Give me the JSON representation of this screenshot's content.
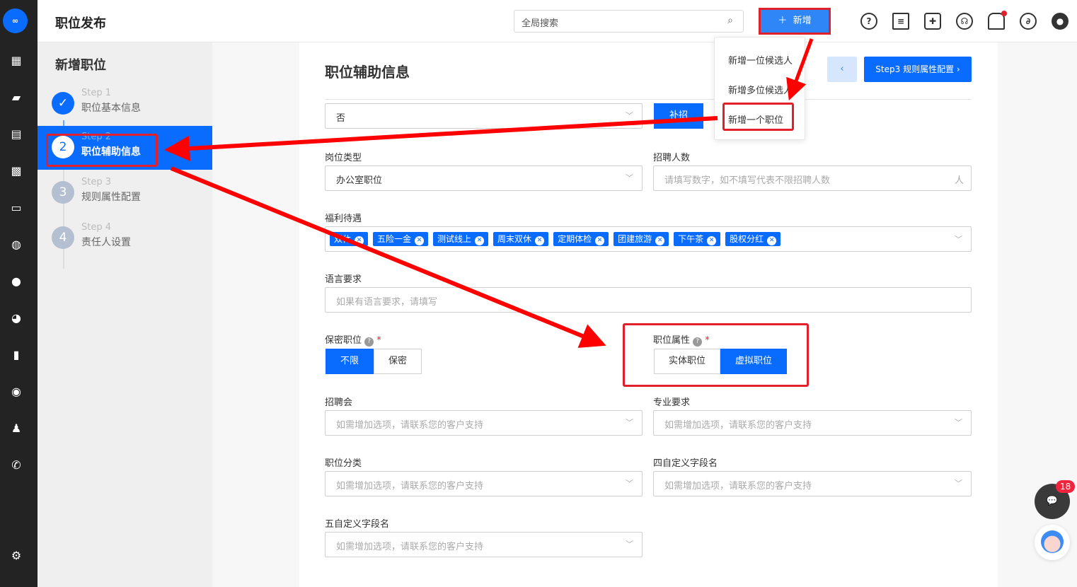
{
  "app": {
    "logo": "BizScenes",
    "page_title": "职位发布"
  },
  "rail": {
    "icons": [
      "dashboard-icon",
      "briefcase-icon",
      "resume-icon",
      "calendar-icon",
      "id-card-icon",
      "wechat-icon",
      "thumbs-up-icon",
      "pie-chart-icon",
      "bar-chart-icon",
      "user-circle-icon",
      "users-icon",
      "phone-icon",
      "settings-icon"
    ]
  },
  "header": {
    "search_placeholder": "全局搜索",
    "add_label": "新增",
    "add_menu": [
      "新增一位候选人",
      "新增多位候选人",
      "新增一个职位"
    ],
    "icons": [
      "help-icon",
      "document-icon",
      "puzzle-icon",
      "head-icon",
      "bell-icon",
      "link-icon",
      "user-icon"
    ]
  },
  "steps": {
    "title": "新增职位",
    "items": [
      {
        "step": "Step 1",
        "label": "职位基本信息",
        "num": "✓"
      },
      {
        "step": "Step 2",
        "label": "职位辅助信息",
        "num": "2"
      },
      {
        "step": "Step 3",
        "label": "规则属性配置",
        "num": "3"
      },
      {
        "step": "Step 4",
        "label": "责任人设置",
        "num": "4"
      }
    ]
  },
  "form": {
    "title": "职位辅助信息",
    "next_label": "Step3 规则属性配置 ›",
    "prev_label": "‹",
    "replenish": {
      "value": "否",
      "button": "补招"
    },
    "post_type": {
      "label": "岗位类型",
      "value": "办公室职位"
    },
    "headcount": {
      "label": "招聘人数",
      "placeholder": "请填写数字，如不填写代表不限招聘人数",
      "unit": "人"
    },
    "benefits": {
      "label": "福利待遇",
      "tags": [
        "双休",
        "五险一金",
        "测试线上",
        "周末双休",
        "定期体检",
        "团建旅游",
        "下午茶",
        "股权分红"
      ]
    },
    "language": {
      "label": "语言要求",
      "placeholder": "如果有语言要求，请填写"
    },
    "secret": {
      "label": "保密职位",
      "options": [
        "不限",
        "保密"
      ],
      "selected": "不限"
    },
    "attribute": {
      "label": "职位属性",
      "options": [
        "实体职位",
        "虚拟职位"
      ],
      "selected": "虚拟职位"
    },
    "job_fair": {
      "label": "招聘会",
      "placeholder": "如需增加选项，请联系您的客户支持"
    },
    "major": {
      "label": "专业要求",
      "placeholder": "如需增加选项，请联系您的客户支持"
    },
    "category": {
      "label": "职位分类",
      "placeholder": "如需增加选项，请联系您的客户支持"
    },
    "custom4": {
      "label": "四自定义字段名",
      "placeholder": "如需增加选项，请联系您的客户支持"
    },
    "custom5": {
      "label": "五自定义字段名",
      "placeholder": "如需增加选项，请联系您的客户支持"
    }
  },
  "widgets": {
    "chat_badge": "18"
  },
  "colors": {
    "primary": "#0a6cff",
    "annotation": "#e0202a",
    "rail": "#232323"
  }
}
